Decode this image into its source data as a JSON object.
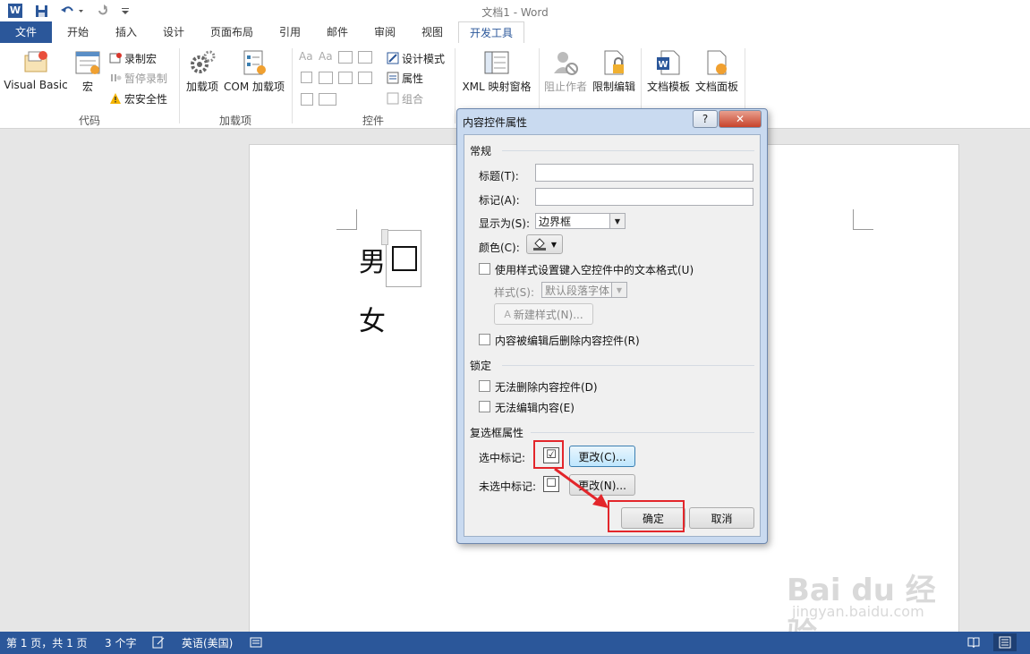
{
  "titlebar": {
    "doc_title": "文档1 - Word",
    "app_icon": "W"
  },
  "tabs": [
    {
      "label": "文件"
    },
    {
      "label": "开始"
    },
    {
      "label": "插入"
    },
    {
      "label": "设计"
    },
    {
      "label": "页面布局"
    },
    {
      "label": "引用"
    },
    {
      "label": "邮件"
    },
    {
      "label": "审阅"
    },
    {
      "label": "视图"
    },
    {
      "label": "开发工具"
    }
  ],
  "ribbon": {
    "code": {
      "label": "代码",
      "visual_basic": "Visual Basic",
      "macro": "宏",
      "record_macro": "录制宏",
      "pause_record": "暂停录制",
      "macro_security": "宏安全性"
    },
    "addins": {
      "label": "加载项",
      "addin": "加载项",
      "com_addin": "COM 加载项"
    },
    "controls": {
      "label": "控件",
      "design_mode": "设计模式",
      "properties": "属性",
      "group": "组合"
    },
    "mapping": {
      "xml_pane": "XML 映射窗格"
    },
    "protect": {
      "block_authors": "阻止作者",
      "restrict_edit": "限制编辑"
    },
    "templates": {
      "doc_template": "文档模板",
      "doc_panel": "文档面板"
    }
  },
  "document": {
    "line1": "男",
    "line2": "女"
  },
  "statusbar": {
    "page": "第 1 页，共 1 页",
    "words": "3 个字",
    "language": "英语(美国)"
  },
  "dialog": {
    "title": "内容控件属性",
    "help_button": "?",
    "close_button": "✕",
    "general": {
      "header": "常规",
      "title_label": "标题(T):",
      "title_value": "",
      "tag_label": "标记(A):",
      "tag_value": "",
      "show_as_label": "显示为(S):",
      "show_as_value": "边界框",
      "color_label": "颜色(C):",
      "use_style_label": "使用样式设置键入空控件中的文本格式(U)",
      "style_label": "样式(S):",
      "style_value": "默认段落字体",
      "new_style_button": "新建样式(N)...",
      "remove_label": "内容被编辑后删除内容控件(R)"
    },
    "locking": {
      "header": "锁定",
      "no_delete_label": "无法删除内容控件(D)",
      "no_edit_label": "无法编辑内容(E)"
    },
    "checkbox_props": {
      "header": "复选框属性",
      "checked_label": "选中标记:",
      "checked_symbol": "☑",
      "checked_change": "更改(C)...",
      "unchecked_label": "未选中标记:",
      "unchecked_symbol": "☐",
      "unchecked_change": "更改(N)..."
    },
    "ok_button": "确定",
    "cancel_button": "取消"
  },
  "watermark": {
    "brand": "Bai du 经验",
    "url": "jingyan.baidu.com"
  },
  "colors": {
    "accent": "#2b579a",
    "highlight": "#e3262b",
    "arrow": "#e3262b"
  }
}
